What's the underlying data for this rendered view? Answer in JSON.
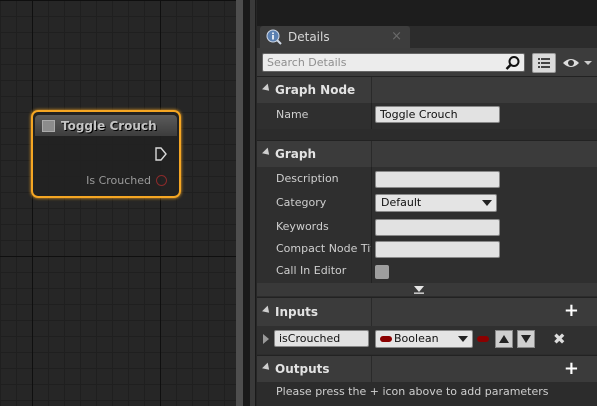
{
  "graph": {
    "node": {
      "title": "Toggle Crouch",
      "output_pin_label": "Is Crouched"
    }
  },
  "details": {
    "tab": {
      "label": "Details",
      "close_glyph": "×",
      "icon": "details-info-icon"
    },
    "search": {
      "placeholder": "Search Details"
    },
    "sections": {
      "graph_node": {
        "label": "Graph Node"
      },
      "graph": {
        "label": "Graph"
      },
      "inputs": {
        "label": "Inputs",
        "add_glyph": "+"
      },
      "outputs": {
        "label": "Outputs",
        "add_glyph": "+"
      }
    },
    "graph_node": {
      "name_label": "Name",
      "name_value": "Toggle Crouch"
    },
    "graph": {
      "description_label": "Description",
      "description_value": "",
      "category_label": "Category",
      "category_value": "Default",
      "keywords_label": "Keywords",
      "keywords_value": "",
      "compact_label": "Compact Node Titl",
      "compact_value": "",
      "call_in_editor_label": "Call In Editor",
      "call_in_editor_checked": false
    },
    "inputs": {
      "params": [
        {
          "name": "isCrouched",
          "type": "Boolean",
          "type_color": "#8b0000"
        }
      ],
      "delete_glyph": "✖"
    },
    "outputs": {
      "hint": "Please press the + icon above to add parameters"
    }
  },
  "colors": {
    "node_selection": "#f5a623",
    "boolean_pin": "#8b0000",
    "panel_bg": "#2c2c2c",
    "graph_bg": "#262626"
  }
}
